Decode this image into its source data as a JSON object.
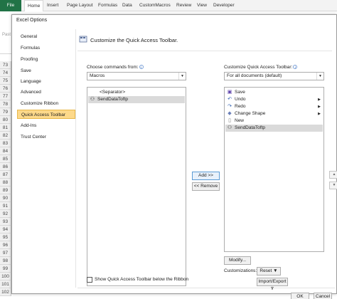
{
  "ribbon": {
    "tabs": [
      "File",
      "Home",
      "Insert",
      "Page Layout",
      "Formulas",
      "Data",
      "CustomMacros",
      "Review",
      "View",
      "Developer"
    ],
    "paste_label": "Past"
  },
  "rows": [
    "73",
    "74",
    "75",
    "76",
    "77",
    "78",
    "79",
    "80",
    "81",
    "82",
    "83",
    "84",
    "85",
    "86",
    "87",
    "88",
    "89",
    "90",
    "91",
    "92",
    "93",
    "94",
    "95",
    "96",
    "97",
    "98",
    "99",
    "100",
    "101",
    "102"
  ],
  "dialog": {
    "title": "Excel Options",
    "nav": [
      "General",
      "Formulas",
      "Proofing",
      "Save",
      "Language",
      "Advanced",
      "Customize Ribbon",
      "Quick Access Toolbar",
      "Add-Ins",
      "Trust Center"
    ],
    "active_nav": "Quick Access Toolbar",
    "header": "Customize the Quick Access Toolbar.",
    "choose_label": "Choose commands from:",
    "choose_value": "Macros",
    "customize_label": "Customize Quick Access Toolbar:",
    "customize_value": "For all documents (default)",
    "left_list": [
      "<Separator>",
      "SendDataToftp"
    ],
    "right_list": [
      {
        "label": "Save",
        "icon": "save-icon",
        "glyph": "▣",
        "color": "#5a3ea8",
        "sub": false
      },
      {
        "label": "Undo",
        "icon": "undo-icon",
        "glyph": "↶",
        "color": "#2a5db0",
        "sub": true
      },
      {
        "label": "Redo",
        "icon": "redo-icon",
        "glyph": "↷",
        "color": "#2a5db0",
        "sub": true
      },
      {
        "label": "Change Shape",
        "icon": "shape-icon",
        "glyph": "◆",
        "color": "#6a7fb8",
        "sub": true
      },
      {
        "label": "New",
        "icon": "new-document-icon",
        "glyph": "▯",
        "color": "#777",
        "sub": false
      },
      {
        "label": "SendDataToftp",
        "icon": "macro-icon",
        "glyph": "⚇",
        "color": "#333",
        "sub": false
      }
    ],
    "add_button": "Add >>",
    "remove_button": "<< Remove",
    "modify_button": "Modify...",
    "customizations_label": "Customizations:",
    "reset_button": "Reset ▼",
    "import_export_button": "Import/Export ▼",
    "show_below_label": "Show Quick Access Toolbar below the Ribbon",
    "ok_button": "OK",
    "cancel_button": "Cancel"
  }
}
